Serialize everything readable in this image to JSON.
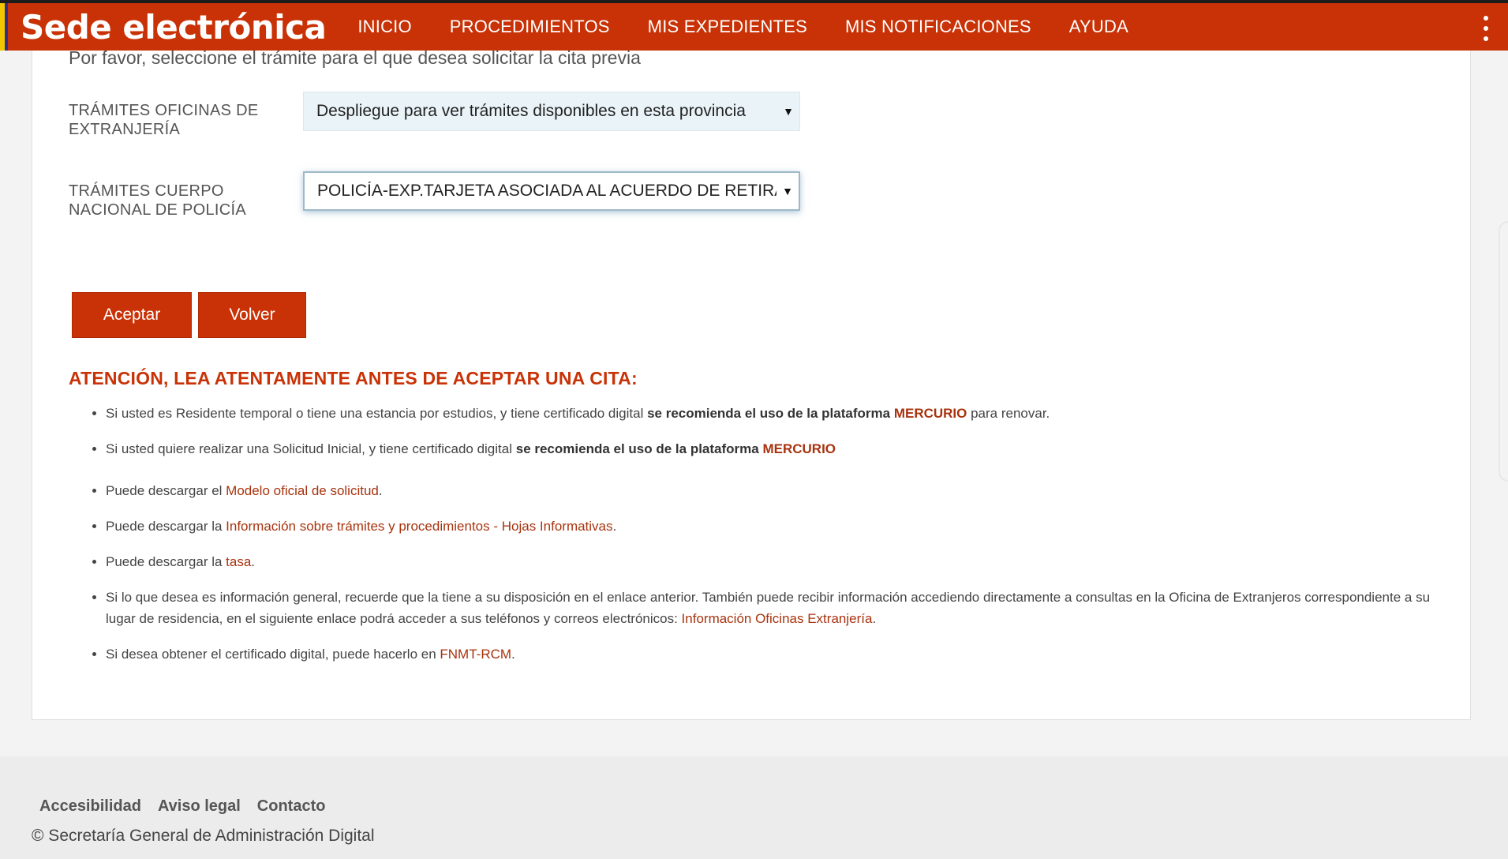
{
  "header": {
    "brand": "Sede electrónica",
    "nav": [
      "INICIO",
      "PROCEDIMIENTOS",
      "MIS EXPEDIENTES",
      "MIS NOTIFICACIONES",
      "AYUDA"
    ],
    "accent_color": "#c83206"
  },
  "form": {
    "intro": "Por favor, seleccione el trámite para el que desea solicitar la cita previa",
    "fields": [
      {
        "label": "TRÁMITES OFICINAS DE EXTRANJERÍA",
        "selected": "Despliegue para ver trámites disponibles en esta provincia"
      },
      {
        "label": "TRÁMITES CUERPO NACIONAL DE POLICÍA",
        "selected": "POLICÍA-EXP.TARJETA ASOCIADA AL ACUERDO DE RETIRADA"
      }
    ],
    "accept_label": "Aceptar",
    "back_label": "Volver"
  },
  "attention": {
    "title": "ATENCIÓN, LEA ATENTAMENTE ANTES DE ACEPTAR UNA CITA:",
    "items": [
      {
        "pre": "Si usted es Residente temporal o tiene una estancia por estudios, y tiene certificado digital ",
        "bold": "se recomienda el uso de la plataforma ",
        "link": "MERCURIO",
        "post": " para renovar."
      },
      {
        "pre": "Si usted quiere realizar una Solicitud Inicial, y tiene certificado digital ",
        "bold": "se recomienda el uso de la plataforma ",
        "link": "MERCURIO",
        "post": ""
      },
      {
        "pre": "Puede descargar el ",
        "link": "Modelo oficial de solicitud",
        "post": "."
      },
      {
        "pre": "Puede descargar la ",
        "link": "Información sobre trámites y procedimientos - Hojas Informativas",
        "post": "."
      },
      {
        "pre": "Puede descargar la ",
        "link": "tasa",
        "post": "."
      },
      {
        "pre": "Si lo que desea es información general, recuerde que la tiene a su disposición en el enlace anterior. También puede recibir información accediendo directamente a consultas en la Oficina de Extranjeros correspondiente a su lugar de residencia, en el siguiente enlace podrá acceder a sus teléfonos y correos electrónicos: ",
        "link": "Información Oficinas Extranjería",
        "post": "."
      },
      {
        "pre": "Si desea obtener el certificado digital, puede hacerlo en ",
        "link": "FNMT-RCM",
        "post": "."
      }
    ]
  },
  "footer": {
    "links": [
      "Accesibilidad",
      "Aviso legal",
      "Contacto"
    ],
    "copyright": "© Secretaría General de Administración Digital"
  }
}
